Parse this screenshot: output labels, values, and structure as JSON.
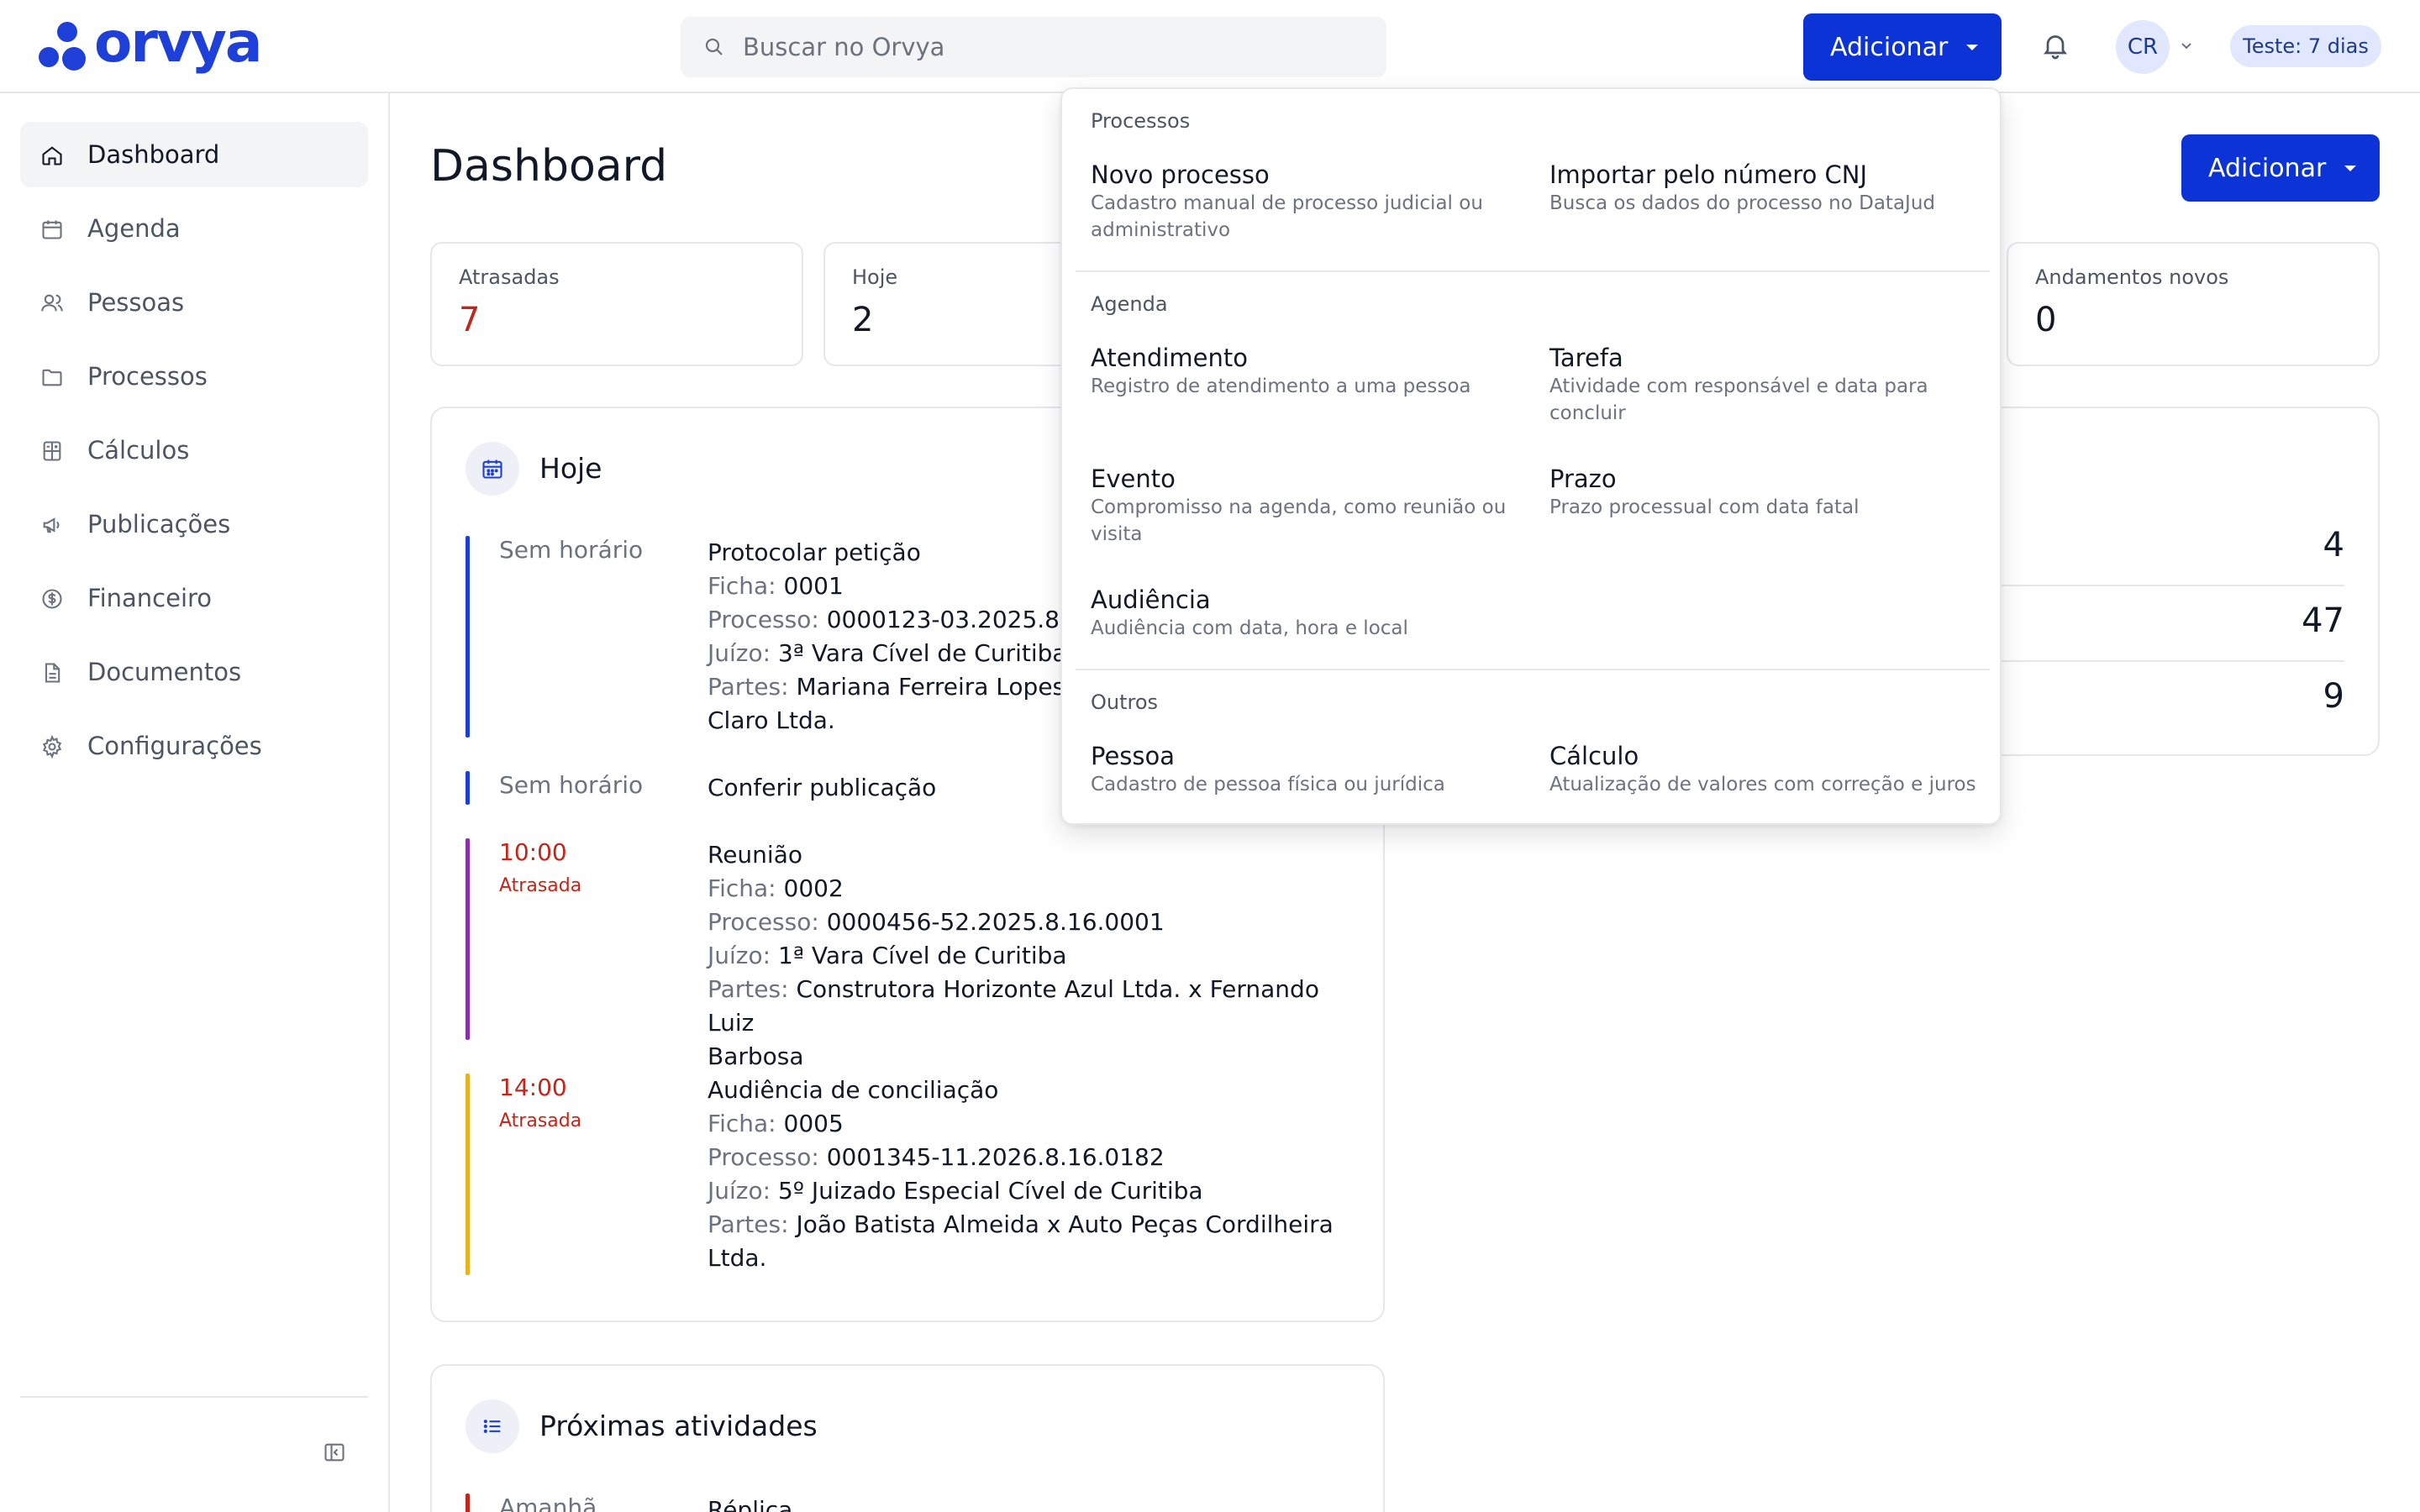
{
  "app": {
    "logo_text": "orvya"
  },
  "header": {
    "search_placeholder": "Buscar no Orvya",
    "add_label": "Adicionar",
    "avatar_initials": "CR",
    "trial_badge": "Teste: 7 dias"
  },
  "sidebar": {
    "items": [
      {
        "label": "Dashboard",
        "icon": "home-icon"
      },
      {
        "label": "Agenda",
        "icon": "calendar-icon"
      },
      {
        "label": "Pessoas",
        "icon": "users-icon"
      },
      {
        "label": "Processos",
        "icon": "folder-icon"
      },
      {
        "label": "Cálculos",
        "icon": "calculator-icon"
      },
      {
        "label": "Publicações",
        "icon": "megaphone-icon"
      },
      {
        "label": "Financeiro",
        "icon": "dollar-circle-icon"
      },
      {
        "label": "Documentos",
        "icon": "document-icon"
      },
      {
        "label": "Configurações",
        "icon": "gear-icon"
      }
    ],
    "active": "Dashboard"
  },
  "main": {
    "title": "Dashboard",
    "add_label": "Adicionar",
    "stats": [
      {
        "label": "Atrasadas",
        "value": "7"
      },
      {
        "label": "Hoje",
        "value": "2"
      },
      {
        "label": "Andamentos novos",
        "value": "0"
      }
    ],
    "today": {
      "title": "Hoje",
      "items": [
        {
          "time": "Sem horário",
          "late": "",
          "title": "Protocolar petição",
          "ficha_label": "Ficha:",
          "ficha": "0001",
          "processo_label": "Processo:",
          "processo": "0000123-03.2025.8",
          "juizo_label": "Juízo:",
          "juizo": "3ª Vara Cível de Curitiba",
          "partes_label": "Partes:",
          "partes": "Mariana Ferreira Lopes x",
          "partes_cont": "Claro Ltda."
        },
        {
          "time": "Sem horário",
          "title": "Conferir publicação"
        },
        {
          "time": "10:00",
          "late": "Atrasada",
          "title": "Reunião",
          "ficha_label": "Ficha:",
          "ficha": "0002",
          "processo_label": "Processo:",
          "processo": "0000456-52.2025.8.16.0001",
          "juizo_label": "Juízo:",
          "juizo": "1ª Vara Cível de Curitiba",
          "partes_label": "Partes:",
          "partes": "Construtora Horizonte Azul Ltda. x Fernando Luiz",
          "partes_cont": "Barbosa"
        },
        {
          "time": "14:00",
          "late": "Atrasada",
          "title": "Audiência de conciliação",
          "ficha_label": "Ficha:",
          "ficha": "0005",
          "processo_label": "Processo:",
          "processo": "0001345-11.2026.8.16.0182",
          "juizo_label": "Juízo:",
          "juizo": "5º Juizado Especial Cível de Curitiba",
          "partes_label": "Partes:",
          "partes": "João Batista Almeida x Auto Peças Cordilheira",
          "partes_cont": "Ltda."
        }
      ]
    },
    "summary_values": [
      "4",
      "47",
      "9"
    ],
    "upcoming": {
      "title": "Próximas atividades",
      "first_time": "Amanhã",
      "first_title": "Réplica"
    }
  },
  "dropdown": {
    "sections": [
      {
        "label": "Processos",
        "items": [
          {
            "title": "Novo processo",
            "desc": "Cadastro manual de processo judicial ou administrativo"
          },
          {
            "title": "Importar pelo número CNJ",
            "desc": "Busca os dados do processo no DataJud"
          }
        ]
      },
      {
        "label": "Agenda",
        "items": [
          {
            "title": "Atendimento",
            "desc": "Registro de atendimento a uma pessoa"
          },
          {
            "title": "Tarefa",
            "desc": "Atividade com responsável e data para concluir"
          },
          {
            "title": "Evento",
            "desc": "Compromisso na agenda, como reunião ou visita"
          },
          {
            "title": "Prazo",
            "desc": "Prazo processual com data fatal"
          },
          {
            "title": "Audiência",
            "desc": "Audiência com data, hora e local"
          }
        ]
      },
      {
        "label": "Outros",
        "items": [
          {
            "title": "Pessoa",
            "desc": "Cadastro de pessoa física ou jurídica"
          },
          {
            "title": "Cálculo",
            "desc": "Atualização de valores com correção e juros"
          }
        ]
      }
    ]
  },
  "colors": {
    "primary": "#0b33d6",
    "late": "#c0261a",
    "bar_blue": "#1d3fd1",
    "bar_purple": "#8b2fa8",
    "bar_yellow": "#e8b11f"
  }
}
